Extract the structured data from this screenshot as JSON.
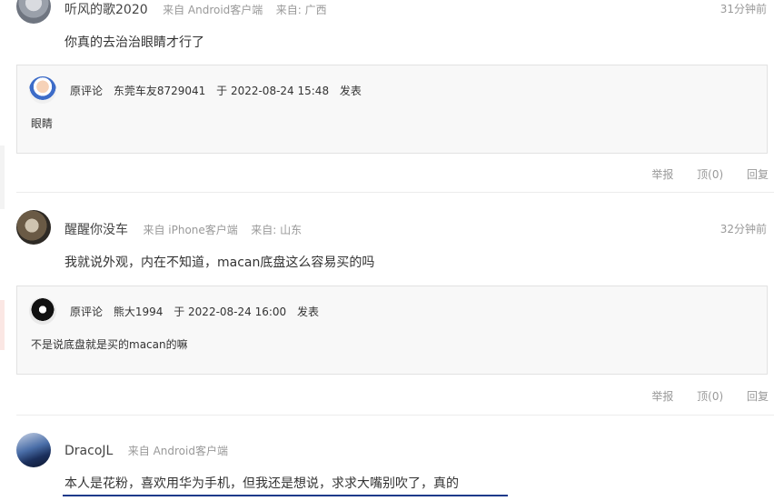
{
  "comments": [
    {
      "user": "听风的歌2020",
      "client": "来自 Android客户端",
      "location": "来自: 广西",
      "time": "31分钟前",
      "text": "你真的去治治眼睛才行了",
      "quote": {
        "label": "原评论",
        "author": "东莞车友8729041",
        "at": "于 2022-08-24 15:48",
        "posted": "发表",
        "text": "眼睛"
      },
      "actions": {
        "report": "举报",
        "up": "顶(0)",
        "reply": "回复"
      }
    },
    {
      "user": "醒醒你没车",
      "client": "来自 iPhone客户端",
      "location": "来自: 山东",
      "time": "32分钟前",
      "text": "我就说外观，内在不知道，macan底盘这么容易买的吗",
      "quote": {
        "label": "原评论",
        "author": "熊大1994",
        "at": "于 2022-08-24 16:00",
        "posted": "发表",
        "text": "不是说底盘就是买的macan的嘛"
      },
      "actions": {
        "report": "举报",
        "up": "顶(0)",
        "reply": "回复"
      }
    },
    {
      "user": "DracoJL",
      "client": "来自 Android客户端",
      "text": "本人是花粉，喜欢用华为手机，但我还是想说，求求大嘴别吹了，真的"
    }
  ]
}
